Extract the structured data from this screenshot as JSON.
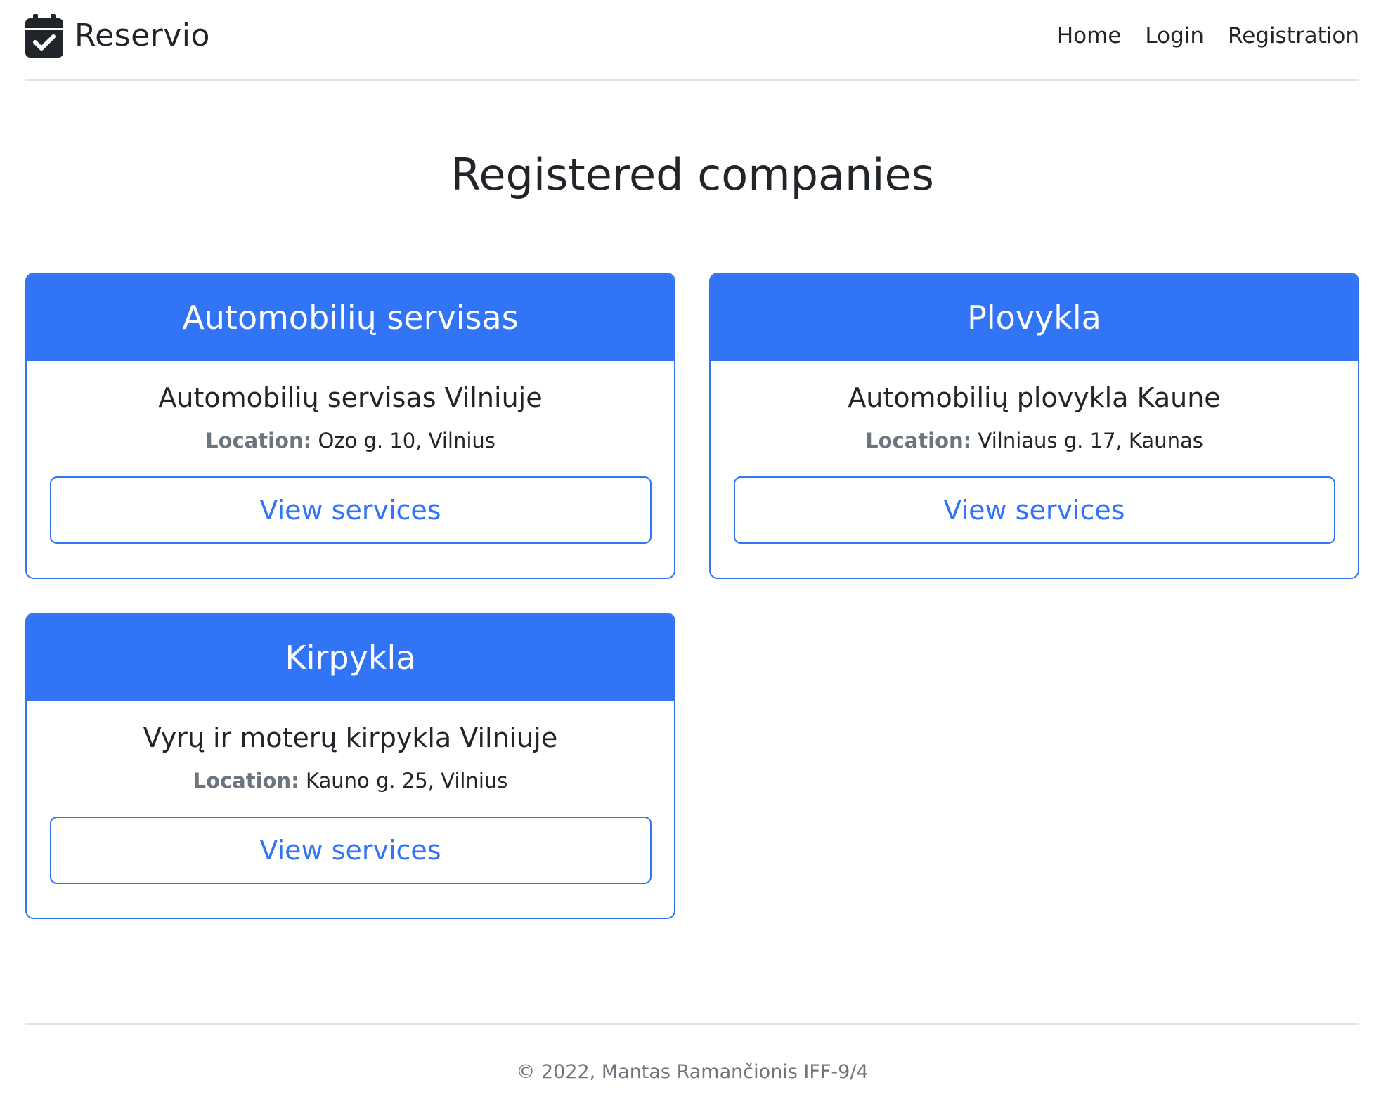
{
  "header": {
    "brand_name": "Reservio",
    "brand_icon": "calendar-check-icon",
    "nav": [
      {
        "label": "Home"
      },
      {
        "label": "Login"
      },
      {
        "label": "Registration"
      }
    ]
  },
  "main": {
    "title": "Registered companies",
    "location_label": "Location:",
    "companies": [
      {
        "category": "Automobilių servisas",
        "name": "Automobilių servisas Vilniuje",
        "location": "Ozo g. 10, Vilnius",
        "button_label": "View services"
      },
      {
        "category": "Plovykla",
        "name": "Automobilių plovykla Kaune",
        "location": "Vilniaus g. 17, Kaunas",
        "button_label": "View services"
      },
      {
        "category": "Kirpykla",
        "name": "Vyrų ir moterų kirpykla Vilniuje",
        "location": "Kauno g. 25, Vilnius",
        "button_label": "View services"
      }
    ]
  },
  "footer": {
    "text": "© 2022, Mantas Ramančionis IFF-9/4"
  },
  "colors": {
    "accent": "#3174f6",
    "text": "#212529",
    "muted": "#6c757d",
    "divider": "#dee2e6"
  }
}
